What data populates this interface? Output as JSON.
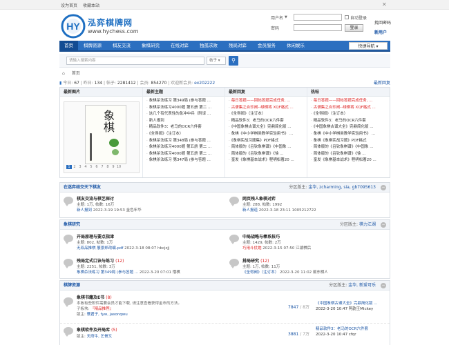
{
  "topbar": {
    "set_home": "设为首页",
    "bookmark": "收藏本站"
  },
  "site": {
    "name": "泓弈棋牌网",
    "url": "www.hychess.com",
    "logo_text": "HY"
  },
  "login": {
    "username_label": "用户名",
    "password_label": "密码",
    "auto_login": "自动登录",
    "submit": "登录",
    "find_password": "找回密码",
    "register": "新用户"
  },
  "nav": {
    "items": [
      "首页",
      "棋牌资源",
      "棋友交流",
      "象棋研究",
      "在线对弈",
      "独孤求败",
      "残局对弈",
      "会员服务",
      "休闲娱乐"
    ],
    "quick": "快捷导航"
  },
  "search": {
    "placeholder": "请输入搜索内容",
    "type": "帖子"
  },
  "breadcrumb": {
    "home": "首页"
  },
  "stats": {
    "today_label": "今日:",
    "today": "67",
    "yesterday_label": "昨日:",
    "yesterday": "134",
    "posts_label": "帖子:",
    "posts": "2281412",
    "members_label": "会员:",
    "members": "854270",
    "newest_label": "欢迎新会员:",
    "newest": "ex202222",
    "latest_reply": "最新回复"
  },
  "grid": {
    "heads": [
      "最新图片",
      "最新主题",
      "最新回复",
      "热帖"
    ],
    "image": {
      "title": "象棋",
      "pages": [
        "1",
        "2",
        "3",
        "4",
        "5",
        "6",
        "7",
        "8",
        "9",
        "10"
      ]
    },
    "new_topics": [
      "象棋杀法练习 第349局 (参与答题 ...",
      "象棋杀法练习4000题 第五册 第二 ...",
      "这几个有代表性的急冲中兵（附译 ...",
      "新人报到",
      "精品软件3：老马的OCR六件套",
      "《全得阀》（注订本）",
      "象棋杀法练习 第348局 (参与答题 ...",
      "象棋杀法练习4000题 第五册 第二 ...",
      "象棋杀法练习4000题 第五册 第二 ...",
      "象棋杀法练习 第347局 (参与答题 ..."
    ],
    "new_replies": [
      "每日答题——回帖答题完成任务, ...",
      "古谱集之合珍阀--绿棋将 XQF格式 ...",
      "《全得阀》（注订本）",
      "精品软件3：老马的OCR六件套",
      "《中国象棋古谱大全》完鼎简化版 ...",
      "象棋《中小学棋类教学实验用书》 ...",
      "《象棋实战习题集》PDF格式",
      "简体版的《吕钦象棋谱》《中国象 ...",
      "简体版的《吕钦象棋谱》《徐 ...",
      "奎发《象棋基本战术》程明松著20 ..."
    ],
    "hot": [
      "每日答题——回帖答题完成任务, ...",
      "古谱集之合珍阀--绿棋将 XQF格式 ...",
      "《全得阀》（注订本）",
      "精品软件3：老马的OCR六件套",
      "《中国象棋古谱大全》完鼎简化版 ...",
      "象棋《中小学棋类教学实验用书》 ...",
      "象棋《象棋实战习题》PDF格式",
      "简体版的《吕钦象棋谱》《中国象 ...",
      "简体版的《吕钦象棋谱》《徐 ...",
      "奎发《象棋基本战术》程明松著20 ..."
    ]
  },
  "sec1": {
    "title": "在迷弈结交天下棋友",
    "mods_label": "分区版主:",
    "mods": "金华, zcharming, sia, gb7095613",
    "forums": [
      {
        "name": "棋友交流与棋艺探讨",
        "cnt": "",
        "stats": "主题: 1万, 帖数: 16万",
        "last_link": "新人报到",
        "last_time": "2022-3-19 19:53 金色年华"
      },
      {
        "name": "网页残人象棋对弈",
        "cnt": "",
        "stats": "主题: 288, 帖数: 1992",
        "last_link": "新人报道",
        "last_time": "2022-3-18 23:11 1005212722"
      }
    ]
  },
  "sec2": {
    "title": "象棋研究",
    "mods_label": "分区版主:",
    "mods": "棋力江湖",
    "forums": [
      {
        "name": "开局原理与要点指津",
        "cnt": "",
        "stats": "主题: 802, 帖数: 1万",
        "last_link": "无双品推棋 展景邦改编.pdf",
        "last_time": "2022-3-18 08:07 hbcjzjj"
      },
      {
        "name": "中局战略与棒系技巧",
        "cnt": "",
        "stats": "主题: 1429, 帖数: 2万",
        "last_link": "巧用斗仗炮",
        "last_time": "2022-3-15 07:50 江湖棋后"
      },
      {
        "name": "残局定式口诀与练习",
        "cnt": "(12)",
        "stats": "主题: 2251, 帖数: 3万",
        "last_link": "象棋杀法练习 第349局 (参与答题 ...",
        "last_time": "2022-3-20 07:01 懵棋"
      },
      {
        "name": "排局研究",
        "cnt": "(12)",
        "stats": "主题: 1万, 帖数: 11万",
        "last_link": "《全得阀》（注订本）",
        "last_time": "2022-3-20 11:02 叛东棋人"
      }
    ]
  },
  "sec3": {
    "title": "棋牌资源",
    "mods_label": "分区版主:",
    "mods": "金华, 新爱可乐",
    "forums": [
      {
        "name": "象棋书籍及E书",
        "cnt": "(8)",
        "desc": "本板有些附件需要会员才能下载, 请注意查看获得金币的方法。",
        "sub_label": "子板块:",
        "sub": "『精品推荐』",
        "mods_label": "版主:",
        "mods": "蓑君子, fyw, jasonqwu",
        "count": "7847",
        "count_sep": " / ",
        "count2": "8万",
        "last_link": "《中国象棋古谱大全》完鼎简化版 ...",
        "last_time": "2022-3-20 10:47 阿韵王Mickey"
      },
      {
        "name": "象棋软件及开局库",
        "cnt": "(5)",
        "desc": "",
        "sub_label": "",
        "sub": "",
        "mods_label": "版主:",
        "mods": "天府牛, 乞骨又",
        "count": "3881",
        "count_sep": " / ",
        "count2": "7万",
        "last_link": "精品软件3：老马的OCR六件套",
        "last_time": "2022-3-20 10:47 cfqr"
      }
    ]
  },
  "colors": {
    "nav": "#2b6fc0",
    "link": "#1a55a5",
    "hot": "#d22222"
  }
}
